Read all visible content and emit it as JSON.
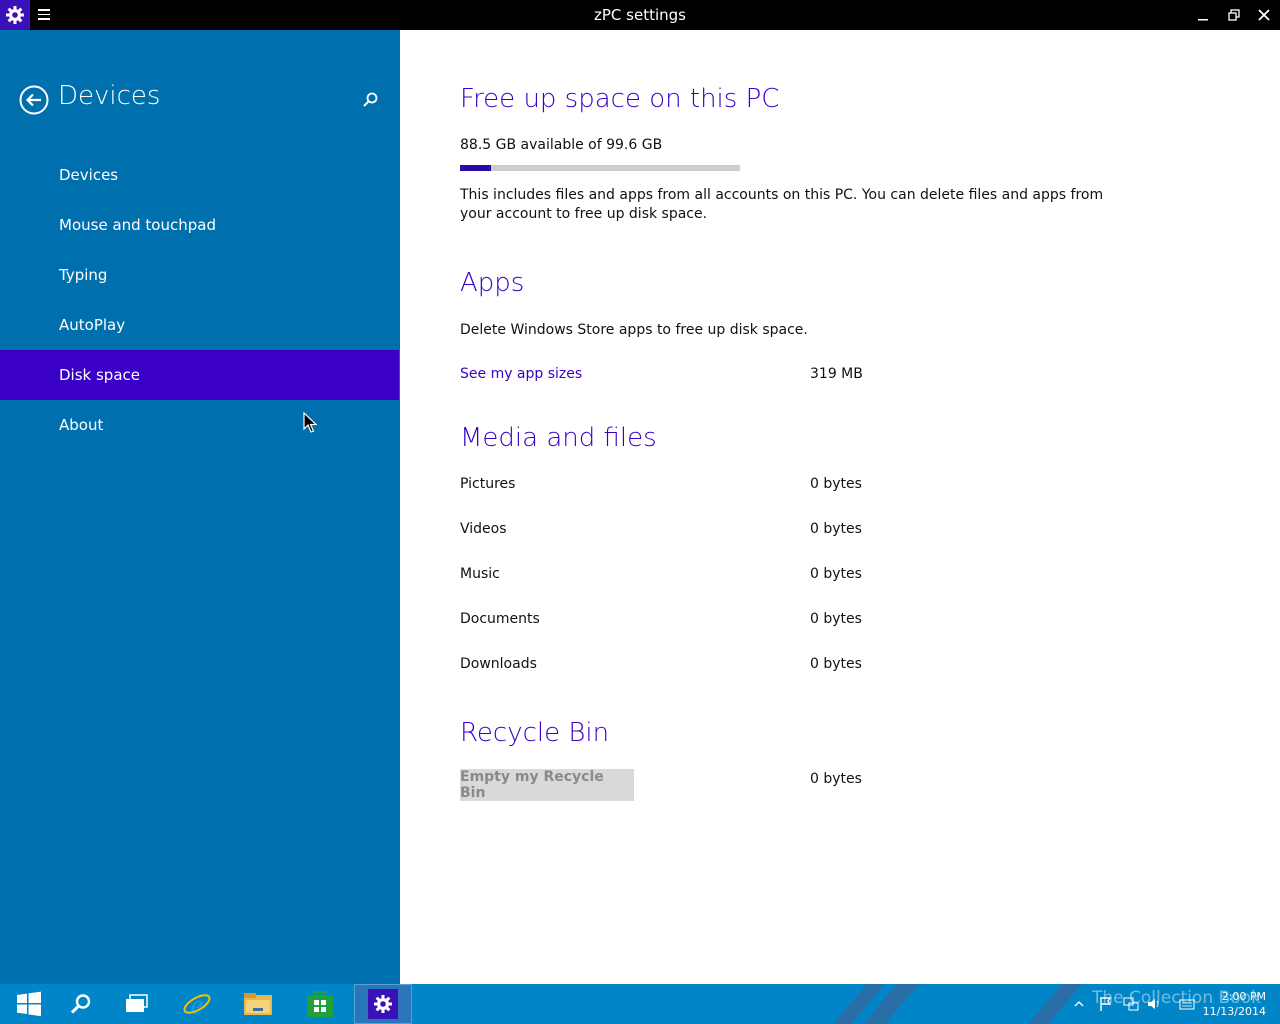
{
  "window": {
    "title": "zPC settings"
  },
  "sidebar": {
    "title": "Devices",
    "items": [
      {
        "label": "Devices"
      },
      {
        "label": "Mouse and touchpad"
      },
      {
        "label": "Typing"
      },
      {
        "label": "AutoPlay"
      },
      {
        "label": "Disk space"
      },
      {
        "label": "About"
      }
    ],
    "selected_index": 4
  },
  "free_space": {
    "heading": "Free up space on this PC",
    "availability": "88.5 GB available of 99.6 GB",
    "used_fraction": 0.111,
    "description_line1": "This includes files and apps from all accounts on this PC. You can delete files and apps from",
    "description_line2": "your account to free up disk space."
  },
  "apps": {
    "heading": "Apps",
    "description": "Delete Windows Store apps to free up disk space.",
    "link": "See my app sizes",
    "size": "319 MB"
  },
  "media": {
    "heading": "Media and files",
    "rows": [
      {
        "label": "Pictures",
        "size": "0 bytes"
      },
      {
        "label": "Videos",
        "size": "0 bytes"
      },
      {
        "label": "Music",
        "size": "0 bytes"
      },
      {
        "label": "Documents",
        "size": "0 bytes"
      },
      {
        "label": "Downloads",
        "size": "0 bytes"
      }
    ]
  },
  "recycle": {
    "heading": "Recycle Bin",
    "button": "Empty my Recycle Bin",
    "size": "0 bytes"
  },
  "taskbar": {
    "time": "2:00 PM",
    "date": "11/13/2014",
    "watermark": "The Collection Book"
  },
  "colors": {
    "accent": "#3a00c6",
    "sidebar": "#006fad",
    "taskbar": "#0086c8"
  }
}
